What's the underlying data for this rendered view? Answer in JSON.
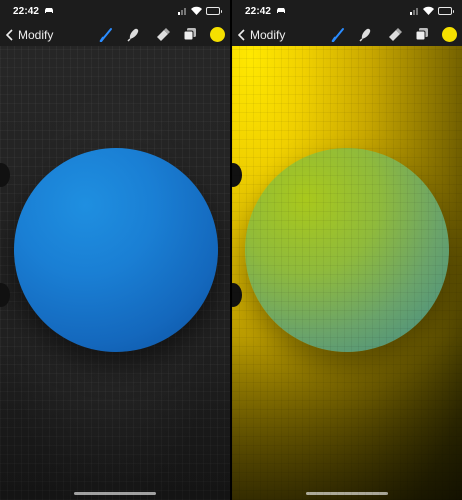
{
  "screens": [
    {
      "id": "before",
      "status": {
        "time": "22:42"
      },
      "toolbar": {
        "back_label": "Modify",
        "tools": [
          "brush-icon",
          "smudge-icon",
          "eraser-icon",
          "layers-icon"
        ],
        "active_tool": "brush-icon",
        "color": "#f5e000"
      },
      "canvas": {
        "background": "dark gray",
        "shape": "circle",
        "shape_color": "#1a7fd4"
      }
    },
    {
      "id": "after",
      "status": {
        "time": "22:42"
      },
      "toolbar": {
        "back_label": "Modify",
        "tools": [
          "brush-icon",
          "smudge-icon",
          "eraser-icon",
          "layers-icon"
        ],
        "active_tool": "brush-icon",
        "color": "#f5e000"
      },
      "canvas": {
        "background": "yellow gradient",
        "shape": "circle",
        "shape_color": "#8fba3c"
      }
    }
  ],
  "colors": {
    "accent_blue": "#2a8cff",
    "swatch_yellow": "#f5e000"
  }
}
